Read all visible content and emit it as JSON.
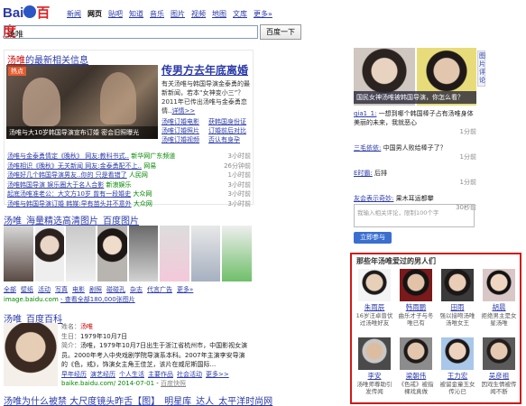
{
  "header": {
    "logo_text_1": "Bai",
    "logo_text_2": "百度",
    "nav": [
      "新闻",
      "网页",
      "贴吧",
      "知道",
      "音乐",
      "图片",
      "视频",
      "地图",
      "文库",
      "更多»"
    ],
    "nav_current": "网页",
    "search_value": "汤唯",
    "search_button": "百度一下"
  },
  "news": {
    "heading_red": "汤唯",
    "heading_rest": "的最新相关信息",
    "image_tag": "热点",
    "image_caption": "汤唯与大10岁韩国导演宣布订婚 密会旧照曝光",
    "top_title": "传男方去年底离婚",
    "summary": "有关汤唯与韩国导演金泰勇的最新新闻，若本“女神变小三”？2011年已传出汤唯与金泰勇恋情..",
    "summary_link": "详情>>",
    "related": [
      "汤唯订婚电影",
      "获韩国身份证",
      "汤唯订婚照片",
      "订婚前后对比",
      "汤唯订婚视频",
      "否认有身孕"
    ],
    "list": [
      {
        "title": "汤唯与金泰勇情定《晚秋》 网友:教科书式..",
        "source": "新华网广东频道",
        "time": "3小时前"
      },
      {
        "title": "汤唯相识《晚秋》无关新闻 网友:金泰勇配不上..",
        "source": "网易",
        "time": "26分钟前"
      },
      {
        "title": "汤唯好几个韩国导演男友..你的 只是看错了",
        "source": "人民网",
        "time": "1小时前"
      },
      {
        "title": "汤唯韩国导演 娱乐圈大于名人合影",
        "source": "新浪娱乐",
        "time": "3小时前"
      },
      {
        "title": "起底汤唯准老公：大文方10岁 曾有一段婚史",
        "source": "大众网",
        "time": "3小时前"
      },
      {
        "title": "汤唯与韩国导演订婚 韩媒:早有苗头并不意外",
        "source": "大众网",
        "time": "3小时前"
      }
    ]
  },
  "images": {
    "heading": "汤唯_海量精选高清图片_百度图片",
    "tags": [
      "全部",
      "壁纸",
      "活动",
      "写真",
      "电影",
      "剧照",
      "碰碰孔",
      "杂志",
      "代言广告",
      "更多»"
    ],
    "url": "image.baidu.com",
    "count_text": "- 查看全部180,000张图片"
  },
  "baike": {
    "heading": "汤唯_百度百科",
    "name_label": "姓名：",
    "name": "汤唯",
    "birth_label": "生日：",
    "birth": "1979年10月7日",
    "intro_label": "简介：",
    "intro": "汤唯，1979年10月7日出生于浙江省杭州市，中国影视女演员。2000年考入中央戏剧学院导演系本科。2007年主演李安导演的《色，戒》，饰演女主角王佳芝，该片在威尼斯国际...",
    "links": [
      "早年经历",
      "演艺经历",
      "个人生活",
      "主要作品",
      "社会活动",
      "更多>>"
    ],
    "url": "baike.baidu.com/",
    "date": "2014-07-01",
    "snapshot": "百度快照"
  },
  "last_result": "汤唯为什么被禁 大尺度镜头昨舌【图】_明星库_达人_太平洋时尚网",
  "right": {
    "photo_caption": "国民女神汤唯被韩国导演，你怎么看？",
    "vertical_tabs": "图片评论",
    "comments": [
      {
        "user": "qia1_1:",
        "text": "一想到哪个韩国棒子占有汤唯身体美丽的未来，我就恶心",
        "time": "1分前"
      },
      {
        "user": "三毛依依:",
        "text": "中国男人败给棒子了？",
        "time": "1分前"
      },
      {
        "user": "E时霸:",
        "text": "后排",
        "time": "1分前"
      },
      {
        "user": "友会表示奇妙:",
        "text": "果木耳运都攀",
        "time": "30秒前"
      }
    ],
    "reply_placeholder": "我输入相关评论，限制100个字",
    "reply_button": "立即参与"
  },
  "men": {
    "title": "那些年汤唯爱过的男人们",
    "people": [
      {
        "name": "朱雨辰",
        "desc": "16岁汪卓曾伏过汤唯好友"
      },
      {
        "name": "韩雨鹏",
        "desc": "曲乐才子与冬唯已有"
      },
      {
        "name": "田雨",
        "desc": "强以接吻汤唯汤唯女王"
      },
      {
        "name": "胡晨",
        "desc": "拒绝男主是女星汤唯"
      },
      {
        "name": "李安",
        "desc": "汤唯师尊助引发传闻"
      },
      {
        "name": "梁朝伟",
        "desc": "《色戒》被指裸戏真做"
      },
      {
        "name": "王力宏",
        "desc": "被留金童玉女传沁已"
      },
      {
        "name": "吴彦祖",
        "desc": "因戏生情被传闻不断"
      }
    ]
  }
}
